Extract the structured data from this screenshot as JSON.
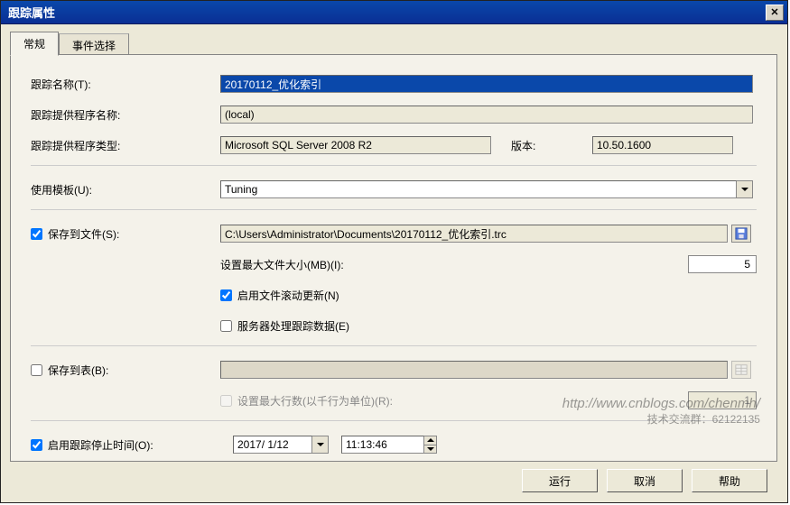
{
  "titlebar": {
    "title": "跟踪属性",
    "close_glyph": "✕"
  },
  "tabs": {
    "general": "常规",
    "events": "事件选择"
  },
  "labels": {
    "trace_name": "跟踪名称(T):",
    "provider_name": "跟踪提供程序名称:",
    "provider_type": "跟踪提供程序类型:",
    "version": "版本:",
    "use_template": "使用模板(U):",
    "save_to_file": "保存到文件(S):",
    "max_file_size": "设置最大文件大小(MB)(I):",
    "enable_rollover": "启用文件滚动更新(N)",
    "server_processes": "服务器处理跟踪数据(E)",
    "save_to_table": "保存到表(B):",
    "max_rows": "设置最大行数(以千行为单位)(R):",
    "enable_stop_time": "启用跟踪停止时间(O):"
  },
  "values": {
    "trace_name": "20170112_优化索引",
    "provider_name": "(local)",
    "provider_type": "Microsoft SQL Server 2008 R2",
    "version": "10.50.1600",
    "template": "Tuning",
    "file_path": "C:\\Users\\Administrator\\Documents\\20170112_优化索引.trc",
    "max_file_size": "5",
    "max_rows": "1",
    "stop_date": "2017/ 1/12",
    "stop_time": "11:13:46"
  },
  "checks": {
    "save_to_file": true,
    "enable_rollover": true,
    "server_processes": false,
    "save_to_table": false,
    "max_rows": false,
    "enable_stop_time": true
  },
  "buttons": {
    "run": "运行",
    "cancel": "取消",
    "help": "帮助"
  },
  "watermark": {
    "url": "http://www.cnblogs.com/chenmh/",
    "qq": "技术交流群：62122135"
  }
}
